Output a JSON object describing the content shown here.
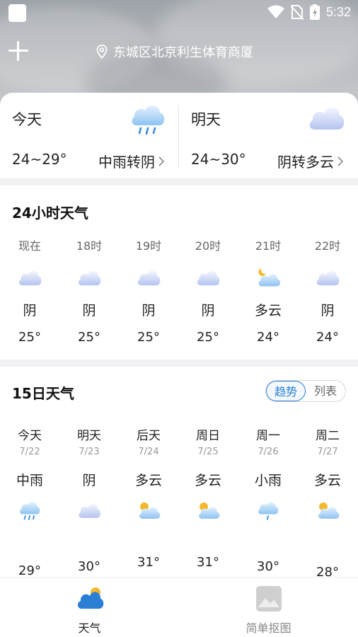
{
  "status": {
    "time": "5:32"
  },
  "header": {
    "location": "东城区北京利生体育商厦"
  },
  "today": {
    "name": "今天",
    "range": "24~29°",
    "condition": "中雨转阴"
  },
  "tomorrow": {
    "name": "明天",
    "range": "24~30°",
    "condition": "阴转多云"
  },
  "hourly": {
    "title": "24小时天气",
    "items": [
      {
        "time": "现在",
        "icon": "cloudy-icon",
        "cond": "阴",
        "temp": "25°"
      },
      {
        "time": "18时",
        "icon": "cloudy-icon",
        "cond": "阴",
        "temp": "25°"
      },
      {
        "time": "19时",
        "icon": "cloudy-icon",
        "cond": "阴",
        "temp": "25°"
      },
      {
        "time": "20时",
        "icon": "cloudy-icon",
        "cond": "阴",
        "temp": "25°"
      },
      {
        "time": "21时",
        "icon": "partly-cloudy-night-icon",
        "cond": "多云",
        "temp": "24°"
      },
      {
        "time": "22时",
        "icon": "cloudy-icon",
        "cond": "阴",
        "temp": "24°"
      }
    ]
  },
  "daily": {
    "title": "15日天气",
    "toggle": {
      "trend": "趋势",
      "list": "列表",
      "active": "trend"
    },
    "items": [
      {
        "day": "今天",
        "date": "7/22",
        "cond": "中雨",
        "icon": "rain-icon",
        "high": "29°"
      },
      {
        "day": "明天",
        "date": "7/23",
        "cond": "阴",
        "icon": "cloudy-icon",
        "high": "30°"
      },
      {
        "day": "后天",
        "date": "7/24",
        "cond": "多云",
        "icon": "partly-cloudy-icon",
        "high": "31°"
      },
      {
        "day": "周日",
        "date": "7/25",
        "cond": "多云",
        "icon": "partly-cloudy-icon",
        "high": "31°"
      },
      {
        "day": "周一",
        "date": "7/26",
        "cond": "小雨",
        "icon": "light-rain-icon",
        "high": "30°"
      },
      {
        "day": "周二",
        "date": "7/27",
        "cond": "多云",
        "icon": "partly-cloudy-icon",
        "high": "28°"
      }
    ]
  },
  "nav": {
    "items": [
      {
        "label": "天气",
        "icon": "weather-icon",
        "active": true
      },
      {
        "label": "简单抠图",
        "icon": "image-icon",
        "active": false
      }
    ]
  },
  "colors": {
    "accent": "#2a7fd4",
    "sun": "#f4b82e"
  }
}
